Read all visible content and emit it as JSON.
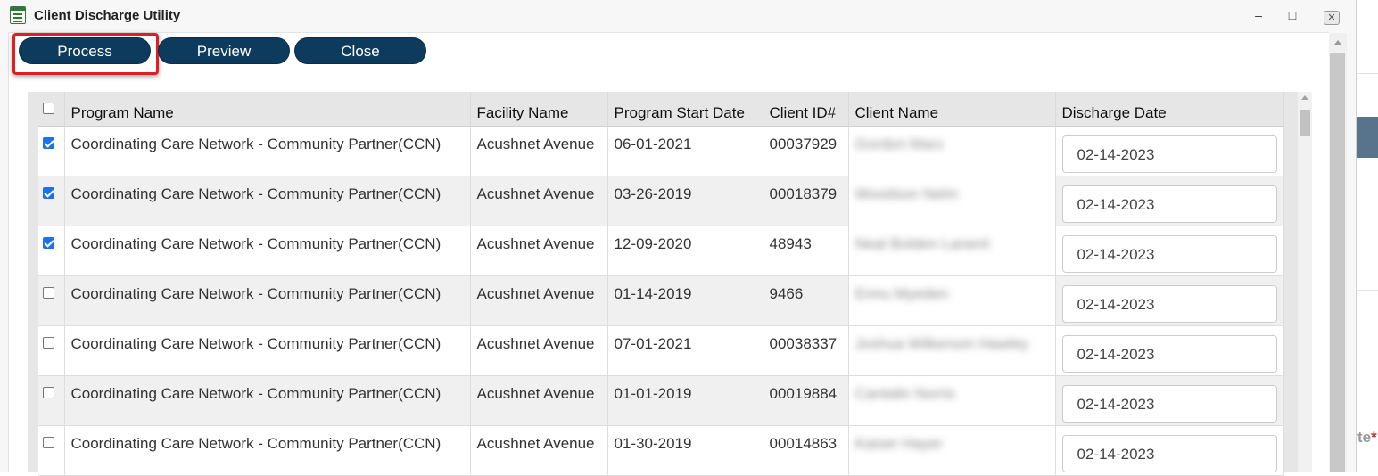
{
  "window": {
    "title": "Client Discharge Utility",
    "controls": {
      "minimize": "–",
      "maximize": "□",
      "close": "✕"
    }
  },
  "toolbar": {
    "process_label": "Process",
    "preview_label": "Preview",
    "close_label": "Close",
    "highlighted_button": "Process"
  },
  "grid": {
    "columns": [
      "Program Name",
      "Facility Name",
      "Program Start Date",
      "Client ID#",
      "Client Name",
      "Discharge Date"
    ],
    "rows": [
      {
        "checked": true,
        "program": "Coordinating Care Network - Community Partner(CCN)",
        "facility": "Acushnet Avenue",
        "start_date": "06-01-2021",
        "client_id": "00037929",
        "client_name": "Gordon Marx",
        "discharge_date": "02-14-2023"
      },
      {
        "checked": true,
        "program": "Coordinating Care Network - Community Partner(CCN)",
        "facility": "Acushnet Avenue",
        "start_date": "03-26-2019",
        "client_id": "00018379",
        "client_name": "Woodson Nelm",
        "discharge_date": "02-14-2023"
      },
      {
        "checked": true,
        "program": "Coordinating Care Network - Community Partner(CCN)",
        "facility": "Acushnet Avenue",
        "start_date": "12-09-2020",
        "client_id": "48943",
        "client_name": "Neal Bolden Lanerd",
        "discharge_date": "02-14-2023"
      },
      {
        "checked": false,
        "program": "Coordinating Care Network - Community Partner(CCN)",
        "facility": "Acushnet Avenue",
        "start_date": "01-14-2019",
        "client_id": "9466",
        "client_name": "Ennu Myeden",
        "discharge_date": "02-14-2023"
      },
      {
        "checked": false,
        "program": "Coordinating Care Network - Community Partner(CCN)",
        "facility": "Acushnet Avenue",
        "start_date": "07-01-2021",
        "client_id": "00038337",
        "client_name": "Joshua Wilkerson Hawley",
        "discharge_date": "02-14-2023"
      },
      {
        "checked": false,
        "program": "Coordinating Care Network - Community Partner(CCN)",
        "facility": "Acushnet Avenue",
        "start_date": "01-01-2019",
        "client_id": "00019884",
        "client_name": "Cantalin Norris",
        "discharge_date": "02-14-2023"
      },
      {
        "checked": false,
        "program": "Coordinating Care Network - Community Partner(CCN)",
        "facility": "Acushnet Avenue",
        "start_date": "01-30-2019",
        "client_id": "00014863",
        "client_name": "Kaiser Hayer",
        "discharge_date": "02-14-2023"
      }
    ]
  },
  "background": {
    "partial_label": "te",
    "required_mark": "*"
  },
  "colors": {
    "button_bg": "#0d3b5e",
    "highlight": "#e21d1d",
    "checkbox": "#1a73e8"
  }
}
